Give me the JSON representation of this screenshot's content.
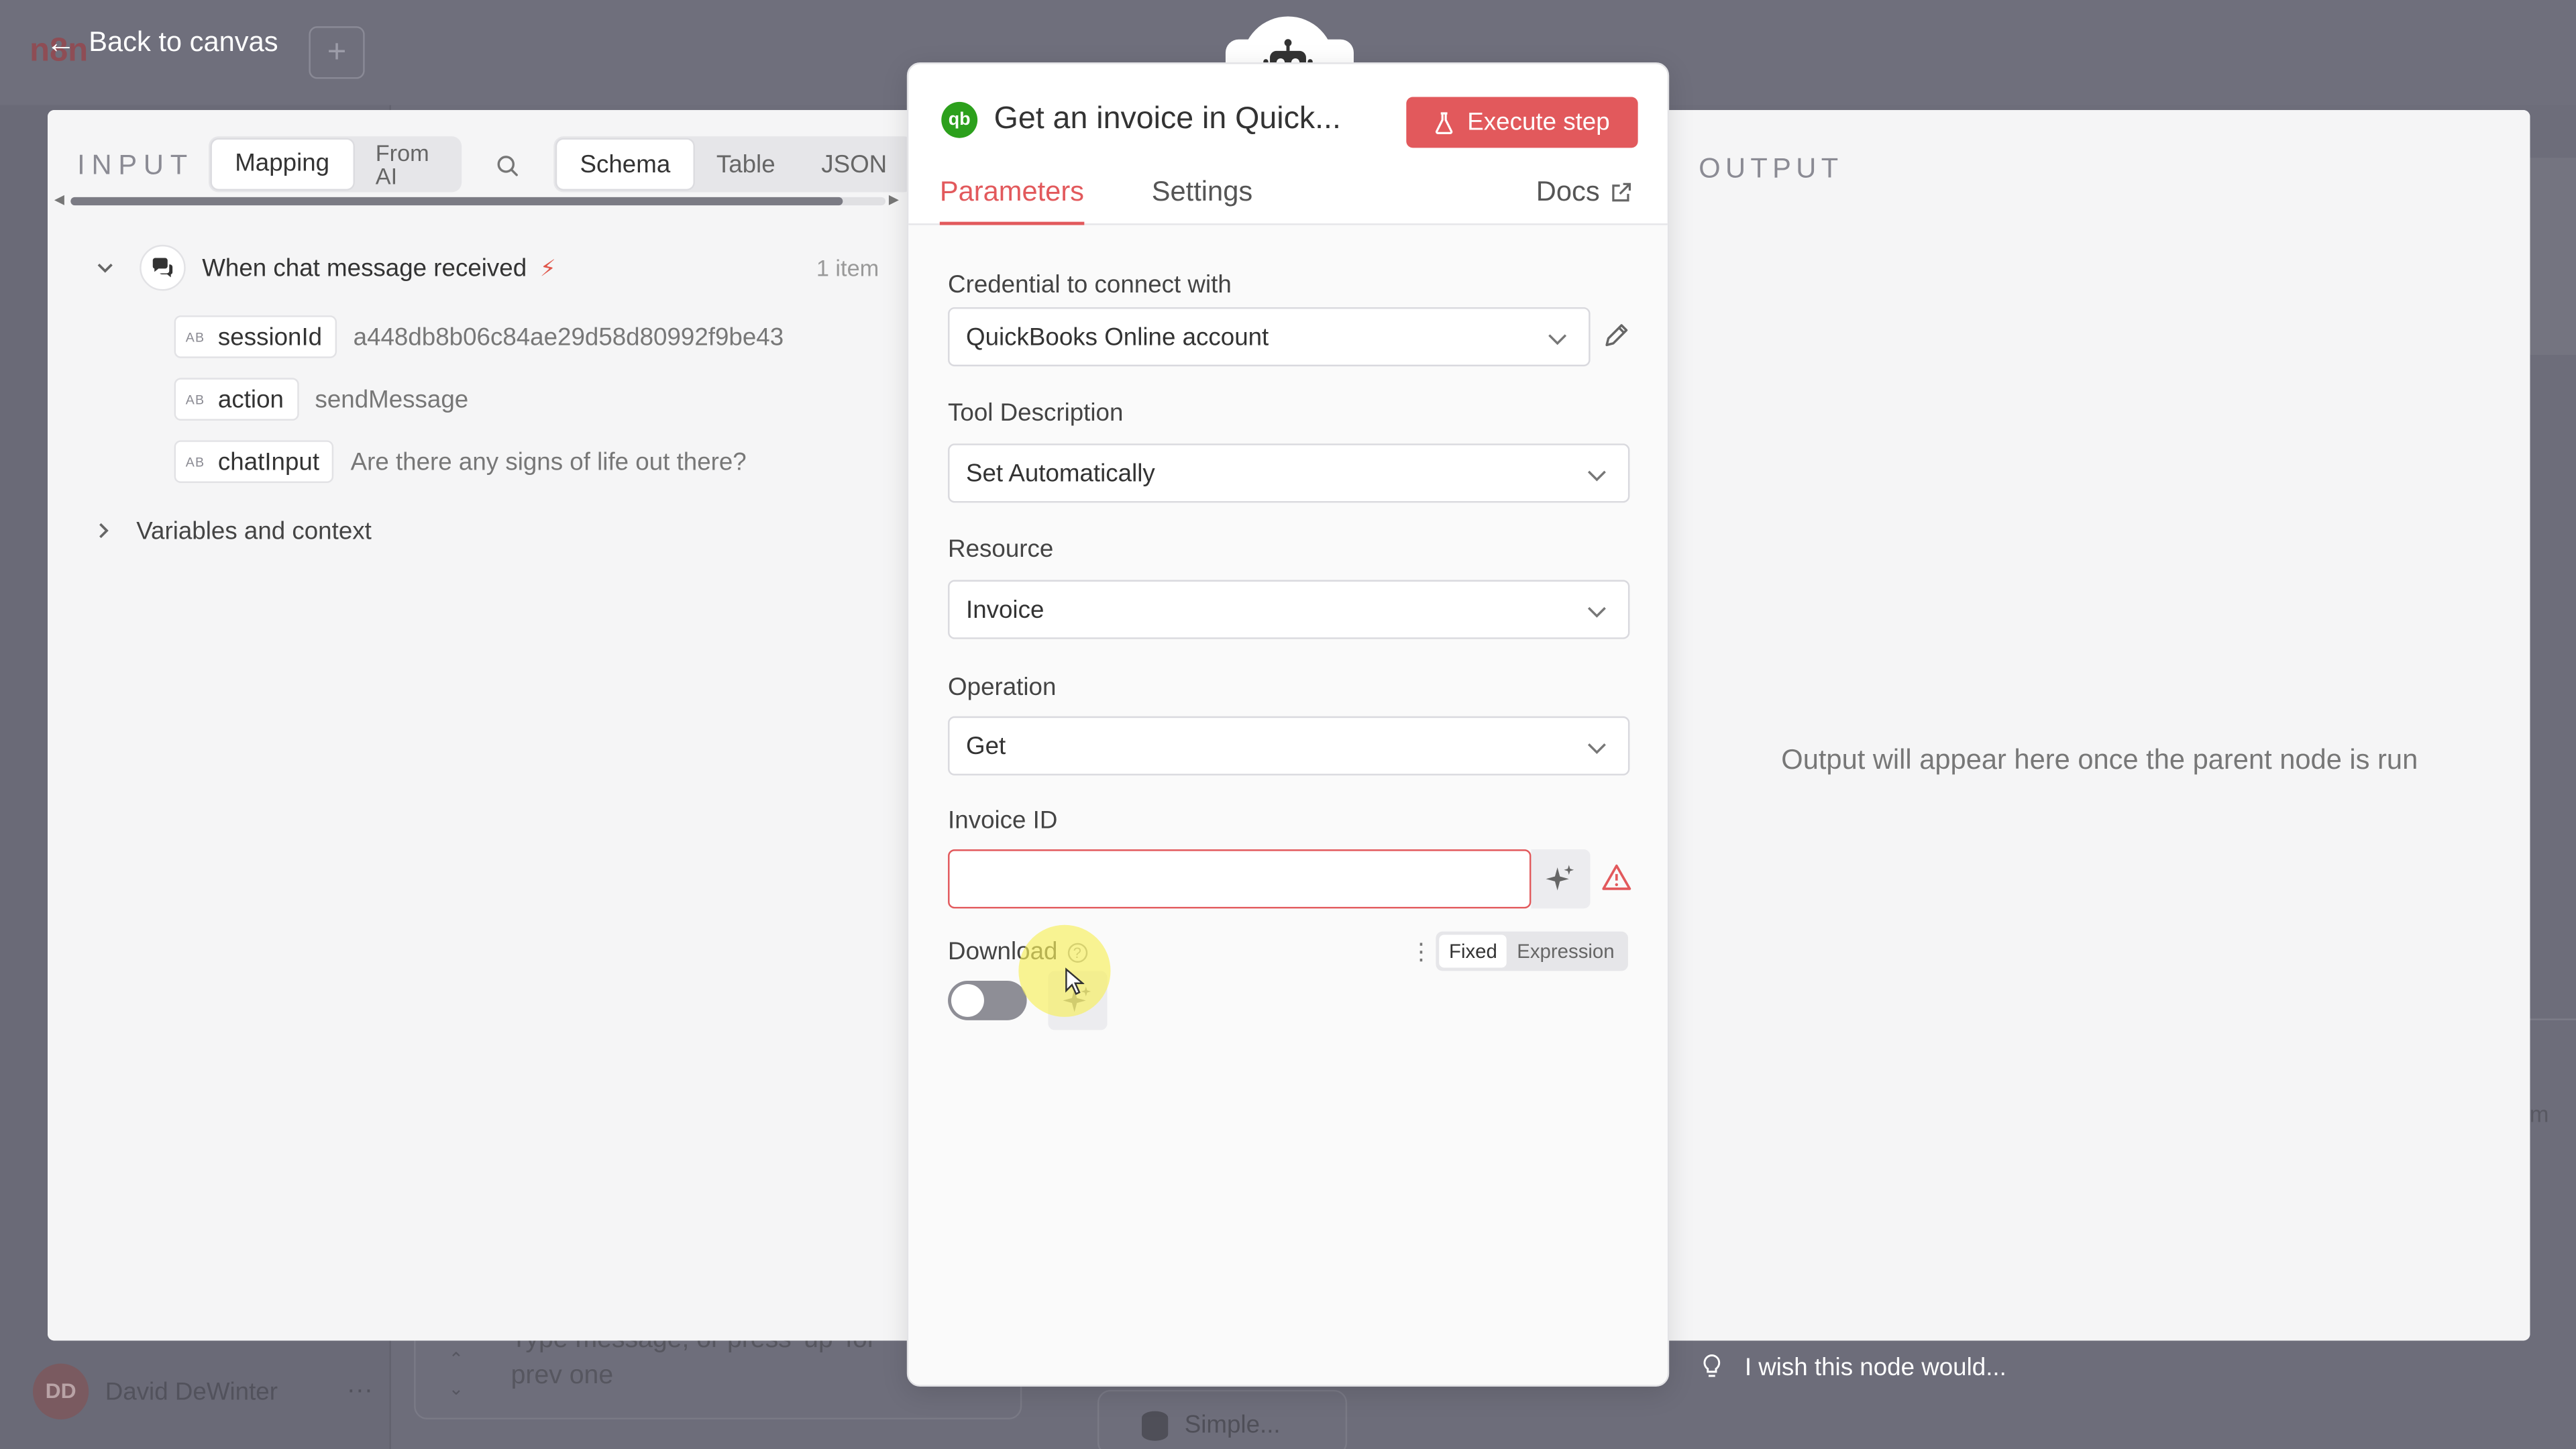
{
  "background": {
    "logo_text": "n8n",
    "user_initials": "DD",
    "user_name": "David DeWinter",
    "user_more": "···",
    "chat_placeholder": "Type message, or press 'up' for prev one",
    "bg_node_label": "Simple...",
    "right_partial_text": "em"
  },
  "back_label": "Back to canvas",
  "input": {
    "title": "INPUT",
    "mode_tabs": [
      "Mapping",
      "From AI"
    ],
    "view_tabs": [
      "Schema",
      "Table",
      "JSON"
    ],
    "trigger_name": "When chat message received",
    "item_count": "1 item",
    "type_badge": "AB",
    "fields": [
      {
        "key": "sessionId",
        "value": "a448db8b06c84ae29d58d80992f9be43"
      },
      {
        "key": "action",
        "value": "sendMessage"
      },
      {
        "key": "chatInput",
        "value": "Are there any signs of life out there?"
      }
    ],
    "vars_label": "Variables and context"
  },
  "node": {
    "title": "Get an invoice in Quick...",
    "execute_label": "Execute step",
    "tabs": [
      "Parameters",
      "Settings"
    ],
    "docs_label": "Docs",
    "credential_label": "Credential to connect with",
    "credential_value": "QuickBooks Online account",
    "tool_desc_label": "Tool Description",
    "tool_desc_value": "Set Automatically",
    "resource_label": "Resource",
    "resource_value": "Invoice",
    "operation_label": "Operation",
    "operation_value": "Get",
    "invoice_id_label": "Invoice ID",
    "invoice_id_value": "",
    "download_label": "Download",
    "download_enabled": false,
    "fixed_label": "Fixed",
    "expression_label": "Expression"
  },
  "output": {
    "title": "OUTPUT",
    "message": "Output will appear here once the parent node is run"
  },
  "feedback_label": "I wish this node would...",
  "colors": {
    "accent": "#e2595c",
    "quickbooks": "#2ca01c",
    "overlay": "#6d6d7a",
    "cursor_highlight": "#f7f05a"
  }
}
